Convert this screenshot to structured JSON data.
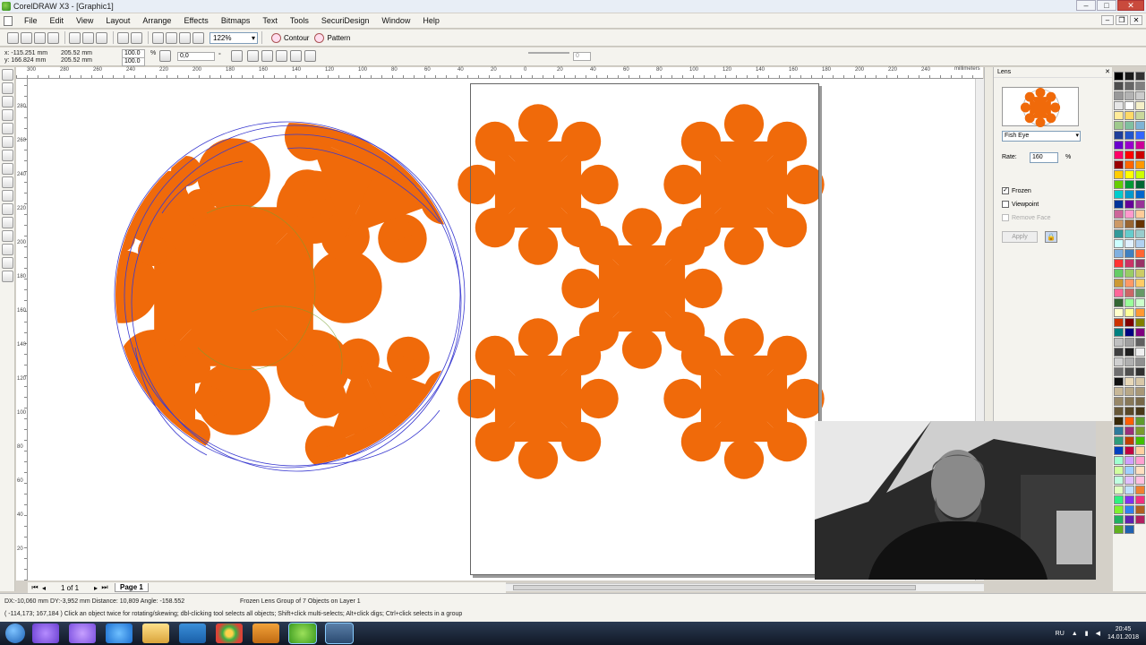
{
  "window": {
    "title": "CorelDRAW X3 - [Graphic1]",
    "min": "–",
    "max": "□",
    "close": "✕"
  },
  "mdi": {
    "min": "–",
    "restore": "❐",
    "close": "✕"
  },
  "menu": [
    "File",
    "Edit",
    "View",
    "Layout",
    "Arrange",
    "Effects",
    "Bitmaps",
    "Text",
    "Tools",
    "SecuriDesign",
    "Window",
    "Help"
  ],
  "toolbar": {
    "zoom": "122%",
    "contour_label": "Contour",
    "pattern_label": "Pattern"
  },
  "propbar": {
    "x": "x: -115.251 mm",
    "y": "y: 166.824 mm",
    "w": "205.52 mm",
    "h": "205.52 mm",
    "scale_w": "100.0",
    "scale_h": "100.0",
    "pct": "%",
    "angle": "0,0",
    "deg": "°",
    "slider_value": "0"
  },
  "ruler": {
    "unit": "millimeters",
    "h_labels": [
      "300",
      "280",
      "260",
      "240",
      "220",
      "200",
      "180",
      "160",
      "140",
      "120",
      "100",
      "80",
      "60",
      "40",
      "20",
      "0",
      "20",
      "40",
      "60",
      "80",
      "100",
      "120",
      "140",
      "160",
      "180",
      "200",
      "220",
      "240",
      "260"
    ],
    "v_labels": [
      "280",
      "260",
      "240",
      "220",
      "200",
      "180",
      "160",
      "140",
      "120",
      "100",
      "80",
      "60",
      "40",
      "20"
    ]
  },
  "pages": {
    "count": "1 of 1",
    "tab": "Page 1"
  },
  "docker": {
    "title": "Lens",
    "lens_type": "Fish Eye",
    "rate_label": "Rate:",
    "rate_value": "160",
    "rate_unit": "%",
    "frozen": "Frozen",
    "viewpoint": "Viewpoint",
    "remove_face": "Remove Face",
    "apply": "Apply",
    "frozen_checked": true
  },
  "status": {
    "line1_left": "DX:-10,060 mm DY:-3,952 mm Distance: 10,809 Angle: -158.552",
    "line1_mid": "Frozen Lens Group of 7 Objects on Layer 1",
    "line2": "( -114,173; 167,184 )  Click an object twice for rotating/skewing; dbl-clicking tool selects all objects; Shift+click multi-selects; Alt+click digs; Ctrl+click selects in a group"
  },
  "tray": {
    "lang": "RU",
    "time": "20:45",
    "date": "14.01.2018"
  },
  "colors": {
    "accent": "#f06a0a",
    "outline": "#3a3ad0",
    "palette": [
      "#000000",
      "#1a1a1a",
      "#333333",
      "#4d4d4d",
      "#666666",
      "#808080",
      "#999999",
      "#b3b3b3",
      "#cccccc",
      "#e6e6e6",
      "#ffffff",
      "#f5f0c8",
      "#ffeb99",
      "#ffd966",
      "#c9d89c",
      "#9fc98c",
      "#80c0a0",
      "#7fb3d5",
      "#1f3f99",
      "#2255cc",
      "#3366ff",
      "#6a00cc",
      "#9900cc",
      "#cc0099",
      "#ff0066",
      "#ff0000",
      "#cc0000",
      "#990000",
      "#ff6600",
      "#ff9900",
      "#ffcc00",
      "#ffff00",
      "#ccff00",
      "#66cc00",
      "#009933",
      "#006633",
      "#00cccc",
      "#0099cc",
      "#0066cc",
      "#003399",
      "#660099",
      "#993399",
      "#cc6699",
      "#ff99cc",
      "#ffcc99",
      "#cc9966",
      "#996633",
      "#663300",
      "#339999",
      "#66cccc",
      "#99cccc",
      "#ccffff",
      "#e0f0ff",
      "#b0d0f0",
      "#80b0e0",
      "#4080c0",
      "#ff6633",
      "#ff3333",
      "#cc3366",
      "#993366",
      "#66cc66",
      "#99cc66",
      "#cccc66",
      "#cc9933",
      "#ff9966",
      "#ffcc66",
      "#ff6699",
      "#cc6666",
      "#669966",
      "#336633",
      "#99ff99",
      "#ccffcc",
      "#ffffcc",
      "#ffff99",
      "#ff9933",
      "#cc3300",
      "#800000",
      "#808000",
      "#008080",
      "#000080",
      "#800080",
      "#c0c0c0",
      "#a0a0a0",
      "#606060",
      "#404040",
      "#202020",
      "#f0f0f0",
      "#d0d0d0",
      "#b0b0b0",
      "#909090",
      "#707070",
      "#505050",
      "#303030",
      "#101010",
      "#e8d8b8",
      "#d8c8a8",
      "#c8b898",
      "#b8a888",
      "#a89878",
      "#988868",
      "#887858",
      "#786848",
      "#685838",
      "#584828",
      "#483818",
      "#382808",
      "#ff5e00",
      "#5e9c2f",
      "#2f7a9c",
      "#9c2f7a",
      "#7a9c2f",
      "#2f9c7a",
      "#c04000",
      "#40c000",
      "#0040c0",
      "#c00040",
      "#ffd0a0",
      "#a0ffd0",
      "#d0a0ff",
      "#ffa0d0",
      "#d0ffa0",
      "#a0d0ff",
      "#ffe0c0",
      "#c0ffe0",
      "#e0c0ff",
      "#ffc0e0",
      "#e0ffc0",
      "#c0e0ff",
      "#f08030",
      "#30f080",
      "#8030f0",
      "#f03080",
      "#80f030",
      "#3080f0",
      "#b06020",
      "#20b060",
      "#6020b0",
      "#b02060",
      "#60b020",
      "#2060b0"
    ]
  }
}
